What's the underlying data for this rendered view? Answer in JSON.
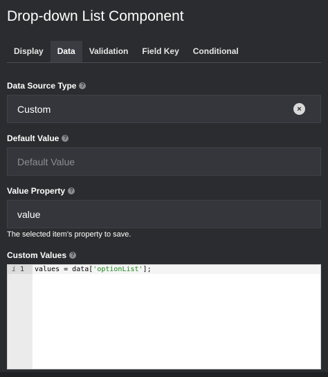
{
  "title": "Drop-down List Component",
  "tabs": [
    {
      "label": "Display",
      "active": false
    },
    {
      "label": "Data",
      "active": true
    },
    {
      "label": "Validation",
      "active": false
    },
    {
      "label": "Field Key",
      "active": false
    },
    {
      "label": "Conditional",
      "active": false
    }
  ],
  "fields": {
    "data_source_type": {
      "label": "Data Source Type",
      "value": "Custom"
    },
    "default_value": {
      "label": "Default Value",
      "placeholder": "Default Value"
    },
    "value_property": {
      "label": "Value Property",
      "value": "value",
      "hint": "The selected item's property to save."
    },
    "custom_values": {
      "label": "Custom Values",
      "editor": {
        "line_number": "1",
        "code_prefix": "values = data[",
        "code_string": "'optionList'",
        "code_suffix": "];"
      }
    }
  },
  "help_glyph": "?",
  "clear_glyph": "×",
  "info_glyph": "i"
}
